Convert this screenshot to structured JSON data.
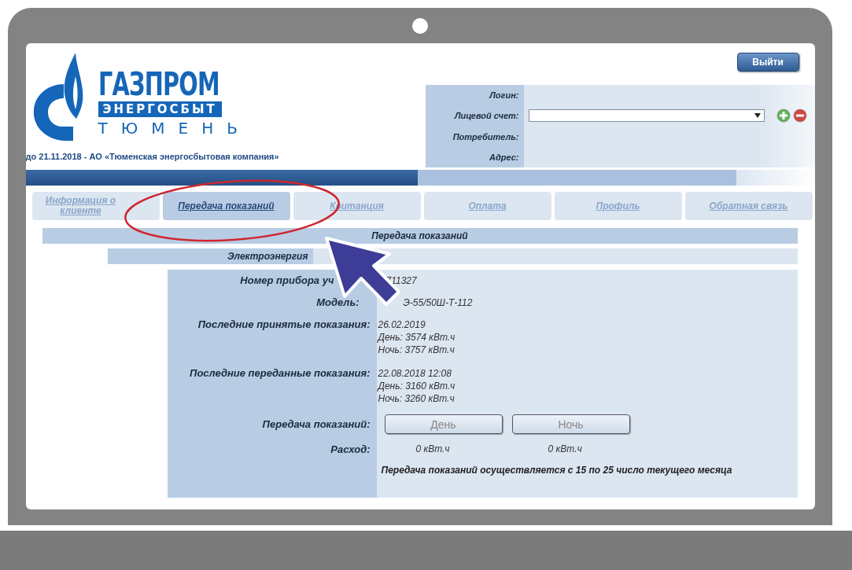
{
  "header": {
    "logo": {
      "title": "ГАЗПРОМ",
      "subtitle": "ЭНЕРГОСБЫТ",
      "city": "ТЮМЕНЬ"
    },
    "former_name": "до 21.11.2018 - АО «Тюменская энергосбытовая компания»",
    "logout_button": "Выйти"
  },
  "account": {
    "fields": [
      {
        "label": "Логин:",
        "kind": "text"
      },
      {
        "label": "Лицевой счет:",
        "kind": "select"
      },
      {
        "label": "Потребитель:",
        "kind": "text"
      },
      {
        "label": "Адрес:",
        "kind": "text"
      }
    ]
  },
  "tabs": [
    {
      "label": "Информация о клиенте",
      "selected": false
    },
    {
      "label": "Передача показаний",
      "selected": true
    },
    {
      "label": "Квитанция",
      "selected": false
    },
    {
      "label": "Оплата",
      "selected": false
    },
    {
      "label": "Профиль",
      "selected": false
    },
    {
      "label": "Обратная связь",
      "selected": false
    }
  ],
  "section_title": "Передача показаний",
  "subsection_title": "Электроэнергия",
  "meter": {
    "rows": [
      {
        "label": "Номер прибора уч",
        "lines": [
          "711327"
        ]
      },
      {
        "label": "Модель:",
        "lines": [
          "Э-55/50Ш-Т-112"
        ]
      },
      {
        "label": "Последние принятые показания:",
        "lines": [
          "26.02.2019",
          "День: 3574 кВт.ч",
          "Ночь: 3757 кВт.ч"
        ]
      },
      {
        "label": "Последние переданные показания:",
        "lines": [
          "22.08.2018 12:08",
          "День: 3160 кВт.ч",
          "Ночь: 3260 кВт.ч"
        ]
      }
    ],
    "submit": {
      "label": "Передача показаний:",
      "buttons": [
        {
          "label": "День",
          "disabled": true
        },
        {
          "label": "Ночь",
          "disabled": true
        }
      ]
    },
    "consumption": {
      "label": "Расход:",
      "values": [
        "0 кВт.ч",
        "0 кВт.ч"
      ]
    },
    "note": "Передача показаний осуществляется с 15 по 25 число текущего месяца"
  }
}
